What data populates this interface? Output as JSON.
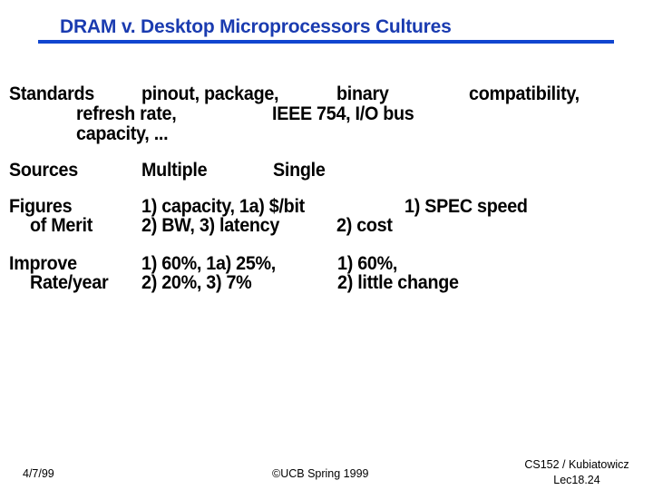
{
  "slide": {
    "title": "DRAM v. Desktop Microprocessors Cultures",
    "accent_color": "#1a3bb0",
    "rows": [
      {
        "label": [
          "Standards"
        ],
        "lines": [
          {
            "a": "pinout, package,",
            "b": "binary",
            "c": "compatibility,"
          },
          {
            "a": "refresh rate,",
            "b": "IEEE 754, I/O bus"
          },
          {
            "a": "capacity, ..."
          }
        ]
      },
      {
        "label": [
          "Sources"
        ],
        "dram": [
          "Multiple"
        ],
        "micro": [
          "Single"
        ]
      },
      {
        "label": [
          "Figures",
          "of Merit"
        ],
        "dram": [
          "1) capacity, 1a) $/bit",
          "2) BW, 3) latency"
        ],
        "micro": [
          "1) SPEC speed",
          "2) cost"
        ]
      },
      {
        "label": [
          "Improve",
          "Rate/year"
        ],
        "dram": [
          "1) 60%, 1a) 25%,",
          "2) 20%, 3) 7%"
        ],
        "micro": [
          "1) 60%,",
          "2) little change"
        ]
      }
    ]
  },
  "footer": {
    "date": "4/7/99",
    "copyright": "©UCB Spring 1999",
    "course": "CS152 / Kubiatowicz",
    "lecture": "Lec18.24"
  }
}
